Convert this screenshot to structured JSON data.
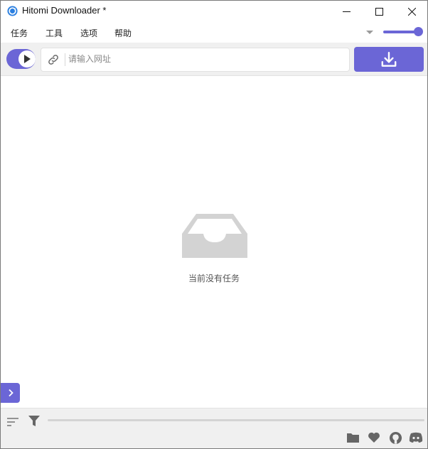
{
  "window": {
    "title": "Hitomi Downloader *",
    "accent_color": "#6b66d6",
    "controls": [
      "minimize-icon",
      "maximize-icon",
      "close-icon"
    ]
  },
  "menu": {
    "items": [
      {
        "label": "任务"
      },
      {
        "label": "工具"
      },
      {
        "label": "选项"
      },
      {
        "label": "帮助"
      }
    ]
  },
  "toolbar": {
    "url_placeholder": "请输入网址",
    "url_value": "",
    "slider_level": 1.0,
    "play_toggle_on": true
  },
  "main": {
    "empty_message": "当前没有任务",
    "empty_icon": "empty-tray-icon"
  },
  "bottom": {
    "progress": 0,
    "icons": [
      "folder-icon",
      "heart-icon",
      "github-icon",
      "discord-icon"
    ]
  }
}
